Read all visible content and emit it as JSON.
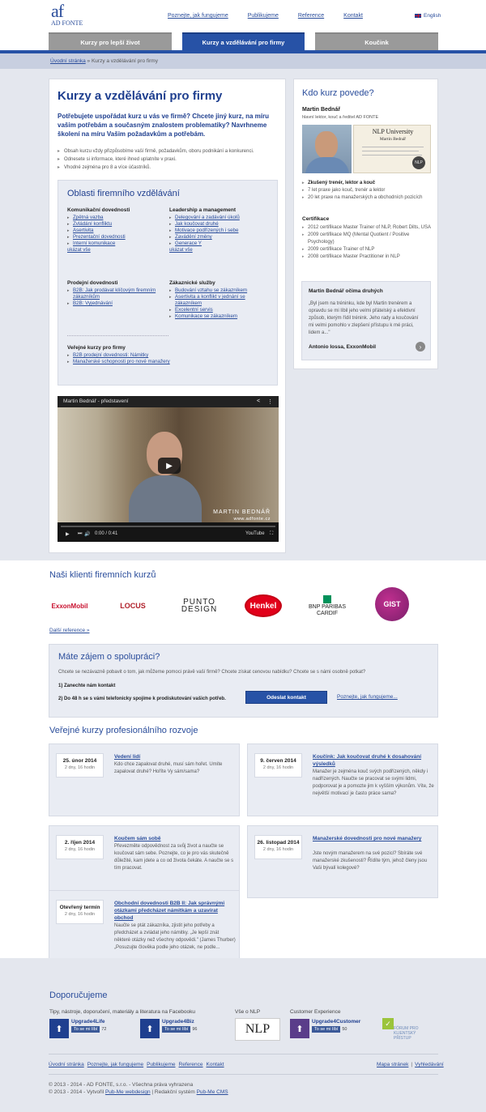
{
  "header": {
    "logo_mark": "af",
    "logo_name": "AD FONTE",
    "nav": [
      "Poznejte, jak fungujeme",
      "Publikujeme",
      "Reference",
      "Kontakt"
    ],
    "language": "English",
    "tabs": [
      "Kurzy pro lepší život",
      "Kurzy a vzdělávání pro firmy",
      "Koučink"
    ],
    "active_tab": 1
  },
  "breadcrumb": {
    "home": "Úvodní stránka",
    "sep": " » ",
    "current": "Kurzy a vzdělávání pro firmy"
  },
  "main": {
    "title": "Kurzy a vzdělávání pro firmy",
    "lead": "Potřebujete uspořádat kurz u vás ve firmě? Chcete jiný kurz, na míru vašim potřebám a současným znalostem problematiky? Navrhneme školení na míru Vašim požadavkům a potřebám.",
    "bullets": [
      "Obsah kurzu vždy přizpůsobíme vaší firmě, požadavkům, oboru podnikání a konkurenci.",
      "Odnesete si informace, které ihned uplatníte v praxi.",
      "Vhodné zejména pro 8 a více účastníků."
    ],
    "areas": {
      "title": "Oblasti firemního vzdělávání",
      "groups": [
        {
          "title": "Komunikační dovednosti",
          "items": [
            "Zpětná vazba",
            "Zvládání konfliktu",
            "Asertivita",
            "Prezentační dovednosti",
            "Interní komunikace"
          ],
          "more": "ukázat vše"
        },
        {
          "title": "Leadership a management",
          "items": [
            "Delegování a zadávání úkolů",
            "Jak koučovat druhé",
            "Motivace podřízených i sebe",
            "Zavádění změny",
            "Generace Y"
          ],
          "more": "ukázat vše"
        },
        {
          "title": "Prodejní dovednosti",
          "items": [
            "B2B: Jak prodávat klíčovým firemním zákazníkům",
            "B2B: Vyjednávání"
          ]
        },
        {
          "title": "Zákaznické služby",
          "items": [
            "Budování vztahu se zákazníkem",
            "Asertivita a konflikt v jednání se zákazníkem",
            "Excelentní servis",
            "Komunikace se zákazníkem"
          ]
        },
        {
          "title": "Veřejné kurzy pro firmy",
          "items": [
            "B2B prodejní dovednosti: Námitky",
            "Manažerské schopnosti pro nové manažery"
          ]
        }
      ]
    },
    "video": {
      "title": "Martin Bednář - představení",
      "caption": "MARTIN BEDNÁŘ",
      "caption_sub": "www.adfonte.cz",
      "time": "0:00 / 0:41",
      "brand": "YouTube"
    }
  },
  "side": {
    "title": "Kdo kurz povede?",
    "name": "Martin Bednář",
    "role": "hlavní lektor, kouč a ředitel AD FONTE",
    "cert_title": "NLP University",
    "cert_name": "Martin Bednář",
    "cert_seal": "NLP",
    "facts": [
      "Zkušený trenér, lektor a kouč",
      "7 let praxe jako kouč, trenér a lektor",
      "20 let praxe na manažerských a obchodních pozicích"
    ],
    "cert_heading": "Certifikace",
    "certs": [
      "2012 certifikace Master Trainer of NLP, Robert Dilts, USA",
      "2009 certifikace MQ (Mental Quotient / Positive Psychology)",
      "2009 certifikace Trainer of NLP",
      "2008 certifikace Master Practitioner in NLP"
    ],
    "quote": {
      "heading": "Martin Bednář očima druhých",
      "text": "„Byl jsem na tréninku, kde byl Martin trenérem a opravdu se mi líbil jeho velmi přátelský a efektivní způsob, kterým řídil trénink. Jeho rady a koučování mi velmi pomohlo v zlepšení přístupu k mé práci, lidem a...\"",
      "author": "Antonio Iossa, ExxonMobil"
    }
  },
  "clients": {
    "title": "Naši klienti firemních kurzů",
    "logos": [
      "ExxonMobil",
      "LOCUS",
      "PUNTO",
      "DESIGN",
      "Henkel",
      "BNP PARIBAS",
      "CARDIF",
      "GIST"
    ],
    "more": "Další reference »"
  },
  "coop": {
    "title": "Máte zájem o spolupráci?",
    "text": "Chcete se nezávazně pobavit o tom, jak můžeme pomoci právě vaší firmě? Chcete získat cenovou nabídku? Chcete se s námi osobně potkat?",
    "step1": "1) Zanechte nám kontakt",
    "step2": "2) Do 48 h se s vámi telefonicky spojíme k prodiskutování vašich potřeb.",
    "button": "Odeslat kontakt",
    "link": "Poznejte, jak fungujeme..."
  },
  "courses": {
    "title": "Veřejné kurzy profesionálního rozvoje",
    "items": [
      {
        "date": "25. únor 2014",
        "dur": "2 dny, 16 hodin",
        "title": "Vedení lidí",
        "desc": "Kdo chce zapalovat druhé, musí sám hořet. Umíte zapalovat druhé? Hoříte Vy sám/sama?"
      },
      {
        "date": "9. červen 2014",
        "dur": "2 dny, 16 hodin",
        "title": "Koučink: Jak koučovat druhé k dosahování výsledků",
        "desc": "Manažer je zejména kouč svých podřízených, někdy i nadřízených. Naučte se pracovat se svými lidmi, podporovat je a pomozte jim k vyšším výkonům. Víte, že největší motivací je často práce sama?"
      },
      {
        "date": "2. říjen 2014",
        "dur": "2 dny, 16 hodin",
        "title": "Koučem sám sobě",
        "desc": "Převezměte odpovědnost za svůj život a naučte se koučovat sám sebe. Poznejte, co je pro vás skutečně důležité, kam jdete a co od života čekáte. A naučte se s tím pracovat."
      },
      {
        "date": "26. listopad 2014",
        "dur": "2 dny, 16 hodin",
        "title": "Manažerské dovednosti pro nové manažery",
        "desc": "Jste novým manažerem na své pozici? Sbíráte své manažerské zkušenosti? Řídíte tým, jehož členy jsou Vaši bývalí kolegové?"
      },
      {
        "date": "Otevřený termín",
        "dur": "2 dny, 16 hodin",
        "title": "Obchodní dovednosti B2B II: Jak správnými otázkami předcházet námitkám a uzavírat obchod",
        "desc": "Naučte se ptát zákazníka, zjistit jeho potřeby a předcházet a zvládat jeho námitky. „Je lepší znát některé otázky než všechny odpovědi.\" (James Thurber) „Posuzujte člověka podle jeho otázek, ne podle..."
      }
    ]
  },
  "footer": {
    "title": "Doporučujeme",
    "fb_heading": "Tipy, nástroje, doporučení, materiály a literatura na Facebooku",
    "nlp_heading": "Vše o NLP",
    "cx_heading": "Customer Experience",
    "like_label": "To se mi líbí",
    "pages": [
      {
        "name": "Upgrade4Life",
        "count": "72"
      },
      {
        "name": "Upgrade4Biz",
        "count": "96"
      },
      {
        "name": "Upgrade4Customer",
        "count": "50"
      }
    ],
    "nlp_logo": "NLP",
    "forum_logo": "FÓRUM PRO KLIENTSKÝ PŘÍSTUP",
    "nav": [
      "Úvodní stránka",
      "Poznejte, jak fungujeme",
      "Publikujeme",
      "Reference",
      "Kontakt"
    ],
    "right_links": [
      "Mapa stránek",
      "Vyhledávání"
    ],
    "copy1": "© 2013 - 2014 - AD FONTE, s.r.o. - Všechna práva vyhrazena",
    "copy2_prefix": "© 2013 - 2014 - Vytvořil ",
    "copy2_link1": "Pub-Me webdesign",
    "copy2_mid": " | Redakční systém ",
    "copy2_link2": "Pub-Me CMS"
  }
}
